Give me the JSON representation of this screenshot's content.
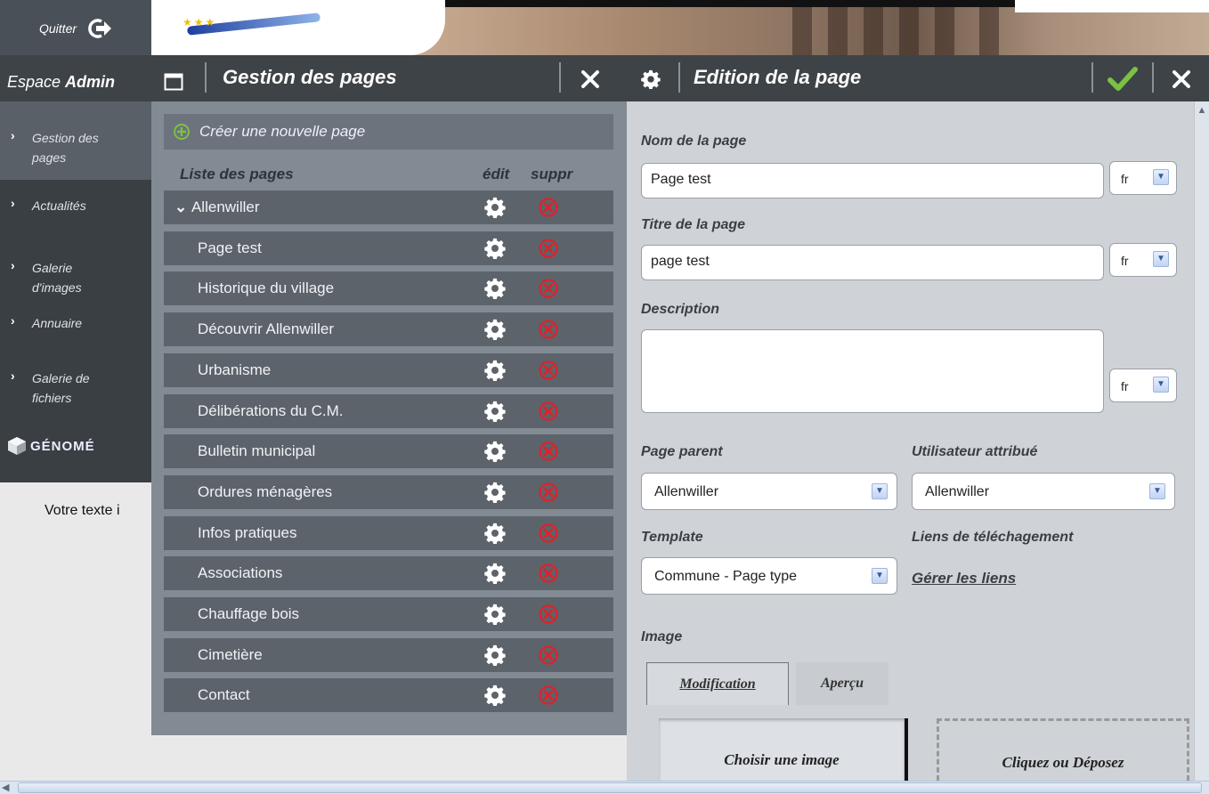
{
  "topbar": {
    "quit_label": "Quitter"
  },
  "admin": {
    "head_prefix": "Espace ",
    "head_bold": "Admin"
  },
  "sidebar": {
    "items": [
      {
        "lines": [
          "Gestion des",
          "pages"
        ],
        "active": true
      },
      {
        "lines": [
          "Actualités"
        ],
        "active": false
      },
      {
        "lines": [
          "Galerie",
          "d'images"
        ],
        "active": false
      },
      {
        "lines": [
          "Annuaire"
        ],
        "active": false
      },
      {
        "lines": [
          "Galerie de",
          "fichiers"
        ],
        "active": false
      }
    ],
    "logo_text": "GÉNOMÉ"
  },
  "body_text": "Votre texte i",
  "pages_panel": {
    "title": "Gestion des pages",
    "create_label": "Créer une nouvelle page",
    "list_header": {
      "title": "Liste des pages",
      "edit": "édit",
      "delete": "suppr"
    },
    "pages": [
      {
        "label": "Allenwiller",
        "top_level": true
      },
      {
        "label": "Page test",
        "top_level": false
      },
      {
        "label": "Historique du village",
        "top_level": false
      },
      {
        "label": "Découvrir Allenwiller",
        "top_level": false
      },
      {
        "label": "Urbanisme",
        "top_level": false
      },
      {
        "label": "Délibérations du C.M.",
        "top_level": false
      },
      {
        "label": "Bulletin municipal",
        "top_level": false
      },
      {
        "label": "Ordures ménagères",
        "top_level": false
      },
      {
        "label": "Infos pratiques",
        "top_level": false
      },
      {
        "label": "Associations",
        "top_level": false
      },
      {
        "label": "Chauffage bois",
        "top_level": false
      },
      {
        "label": "Cimetière",
        "top_level": false
      },
      {
        "label": "Contact",
        "top_level": false
      }
    ]
  },
  "edit_panel": {
    "title": "Edition de la page",
    "name_label": "Nom de la page",
    "name_value": "Page test",
    "name_lang": "fr",
    "title_label": "Titre de la page",
    "title_value": "page test",
    "title_lang": "fr",
    "description_label": "Description",
    "description_value": "",
    "description_lang": "fr",
    "parent_label": "Page parent",
    "parent_value": "Allenwiller",
    "user_label": "Utilisateur attribué",
    "user_value": "Allenwiller",
    "template_label": "Template",
    "template_value": "Commune - Page type",
    "download_label": "Liens de téléchagement",
    "manage_links": "Gérer les liens",
    "image_label": "Image",
    "tab_modification": "Modification",
    "tab_preview": "Aperçu",
    "choose_image": "Choisir une image",
    "drop_zone": "Cliquez ou Déposez"
  },
  "colors": {
    "accent_green": "#7bc142",
    "delete_red": "#e0202a",
    "panel_dark": "#3e4347"
  }
}
